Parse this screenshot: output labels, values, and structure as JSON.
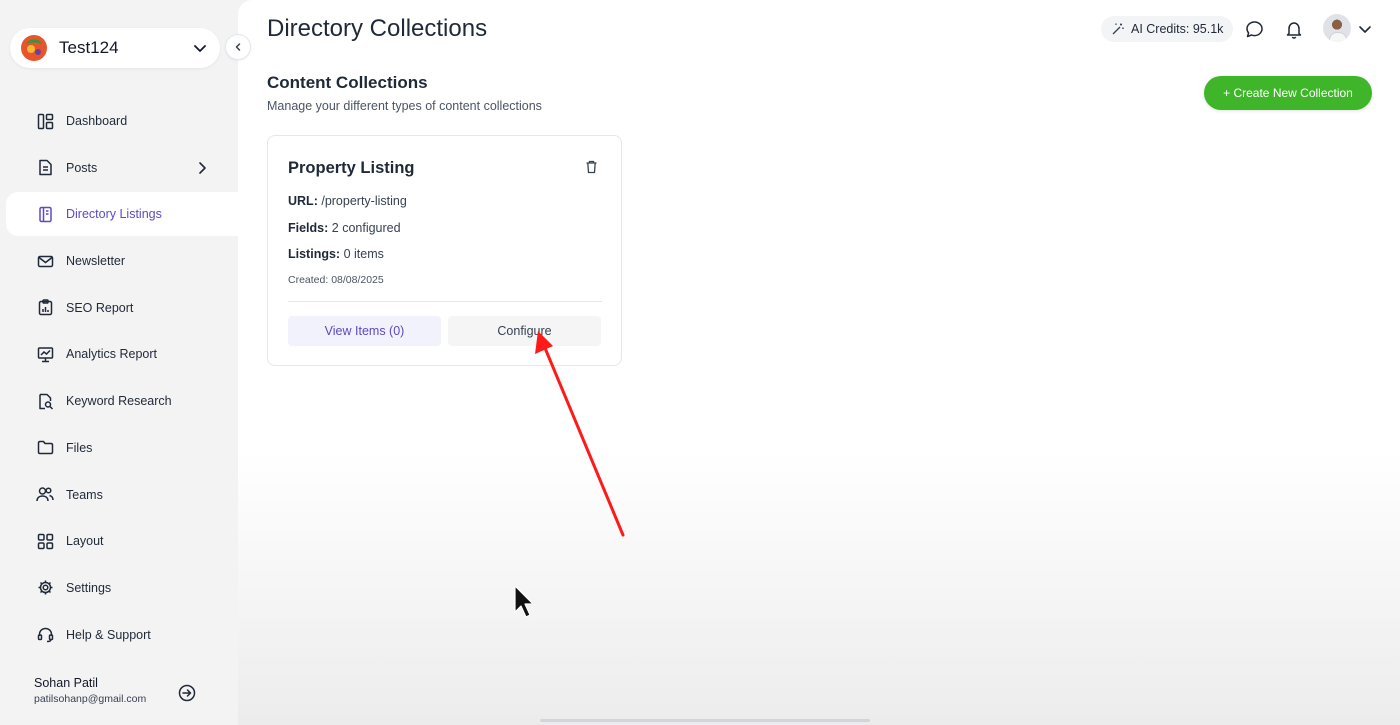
{
  "workspace": {
    "name": "Test124"
  },
  "sidebar": {
    "items": [
      {
        "label": "Dashboard",
        "icon": "dashboard-icon"
      },
      {
        "label": "Posts",
        "icon": "document-icon"
      },
      {
        "label": "Directory Listings",
        "icon": "book-icon"
      },
      {
        "label": "Newsletter",
        "icon": "mail-icon"
      },
      {
        "label": "SEO Report",
        "icon": "clipboard-chart-icon"
      },
      {
        "label": "Analytics Report",
        "icon": "monitor-chart-icon"
      },
      {
        "label": "Keyword Research",
        "icon": "file-search-icon"
      },
      {
        "label": "Files",
        "icon": "folder-icon"
      },
      {
        "label": "Teams",
        "icon": "users-icon"
      },
      {
        "label": "Layout",
        "icon": "grid-icon"
      },
      {
        "label": "Settings",
        "icon": "gear-icon"
      },
      {
        "label": "Help & Support",
        "icon": "headset-icon"
      }
    ],
    "active": "Directory Listings",
    "user": {
      "name": "Sohan Patil",
      "email": "patilsohanp@gmail.com"
    }
  },
  "header": {
    "title": "Directory Collections",
    "credits": "AI Credits: 95.1k"
  },
  "section": {
    "title": "Content Collections",
    "subtitle": "Manage your different types of content collections",
    "create_label": "+ Create New Collection"
  },
  "collection": {
    "title": "Property Listing",
    "url_label": "URL:",
    "url_value": "/property-listing",
    "fields_label": "Fields:",
    "fields_value": "2 configured",
    "listings_label": "Listings:",
    "listings_value": "0 items",
    "created": "Created: 08/08/2025",
    "view_label": "View Items (0)",
    "configure_label": "Configure"
  },
  "colors": {
    "accent": "#5b4bc4",
    "create_button": "#3fb62a",
    "annotation_arrow": "#ff1a1a"
  }
}
